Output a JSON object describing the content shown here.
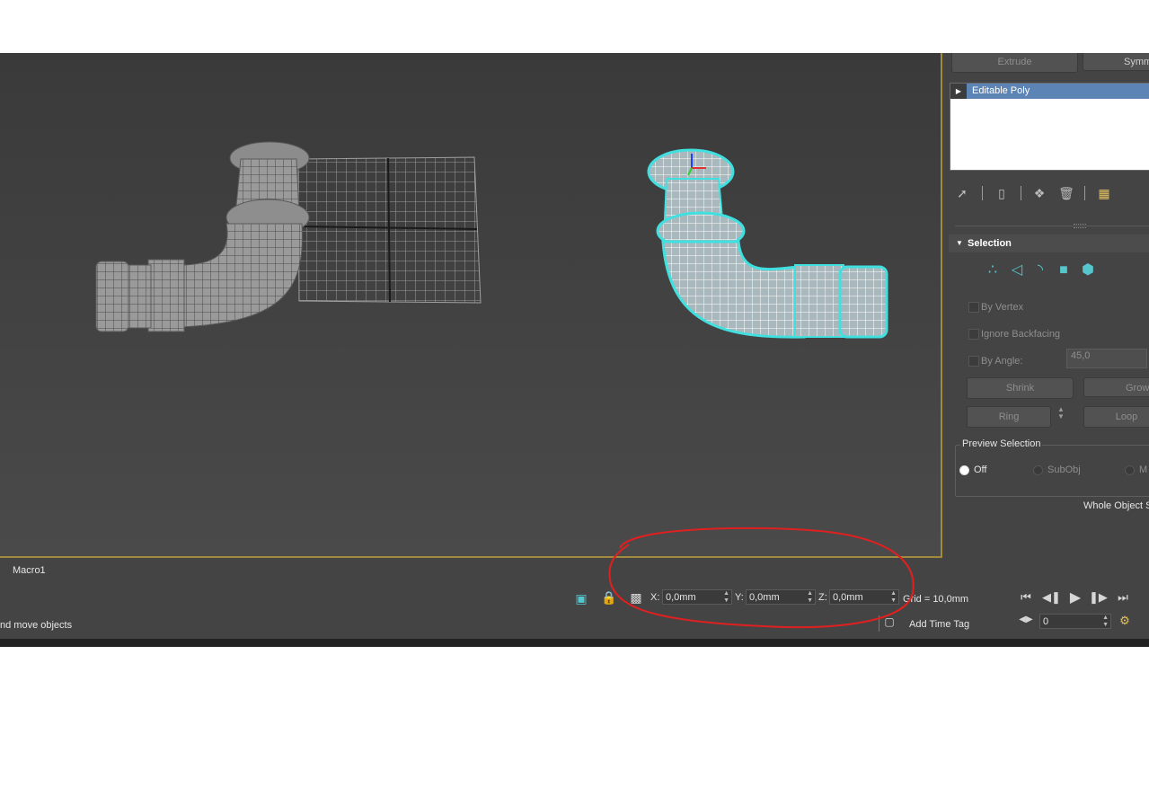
{
  "command_panel": {
    "extrude_label": "Extrude",
    "symmetry_label": "Symm",
    "modifier_stack": [
      "Editable Poly"
    ],
    "selection_rollout": {
      "title": "Selection",
      "by_vertex": "By Vertex",
      "ignore_backfacing": "Ignore Backfacing",
      "by_angle": "By Angle:",
      "angle_value": "45,0",
      "shrink": "Shrink",
      "grow": "Grow",
      "ring": "Ring",
      "loop": "Loop",
      "preview_selection": "Preview Selection",
      "preview_options": [
        "Off",
        "SubObj",
        "M"
      ],
      "preview_selected": "Off",
      "whole_object": "Whole Object S"
    }
  },
  "status_bar": {
    "macro_label": "Macro1",
    "prompt": "nd move objects",
    "x_label": "X:",
    "x_value": "0,0mm",
    "y_label": "Y:",
    "y_value": "0,0mm",
    "z_label": "Z:",
    "z_value": "0,0mm",
    "grid_text": "Grid = 10,0mm",
    "add_time_tag": "Add Time Tag",
    "frame_value": "0"
  },
  "icons": [
    "pin-icon",
    "show-end-result-icon",
    "make-unique-icon",
    "remove-modifier-icon",
    "configure-sets-icon",
    "vertex-icon",
    "edge-icon",
    "border-icon",
    "polygon-icon",
    "element-icon",
    "isolate-icon",
    "lock-icon",
    "transform-mode-icon",
    "time-tag-icon",
    "goto-start-icon",
    "prev-frame-icon",
    "play-icon",
    "next-frame-icon",
    "goto-end-icon",
    "key-mode-icon",
    "time-config-icon"
  ],
  "colors": {
    "selection_highlight": "#5c84b4",
    "selected_mesh_outline": "#40e0e0",
    "viewport_border": "#a08a3c",
    "annotation_circle": "#e02020"
  }
}
